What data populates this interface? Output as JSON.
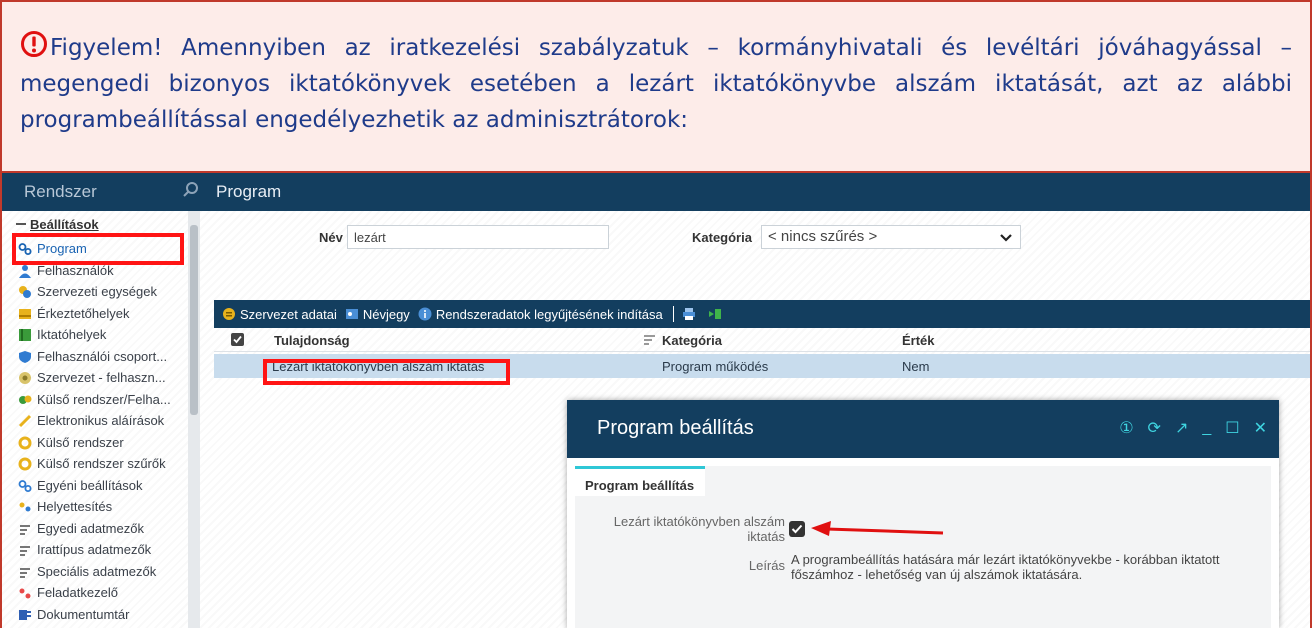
{
  "notice": {
    "text": "Figyelem! Amennyiben az iratkezelési szabályzatuk – kormányhivatali és levéltári jóváhagyással – megengedi bizonyos iktatókönyvek esetében a lezárt iktatókönyvbe alszám iktatását, azt az alábbi programbeállítással engedélyezhetik az adminisztrátorok:",
    "color": "#1f3b8a",
    "border_color": "#c0392b"
  },
  "topbar": {
    "left_title": "Rendszer",
    "right_title": "Program"
  },
  "sidebar": {
    "root": "Beállítások",
    "items": [
      {
        "label": "Program",
        "icon": "gears-icon"
      },
      {
        "label": "Felhasználók",
        "icon": "user-icon"
      },
      {
        "label": "Szervezeti egységek",
        "icon": "org-icon"
      },
      {
        "label": "Érkeztetőhelyek",
        "icon": "inbox-icon"
      },
      {
        "label": "Iktatóhelyek",
        "icon": "book-icon"
      },
      {
        "label": "Felhasználói csoport...",
        "icon": "shield-icon"
      },
      {
        "label": "Szervezet - felhaszn...",
        "icon": "org-user-icon"
      },
      {
        "label": "Külső rendszer/Felha...",
        "icon": "external-user-icon"
      },
      {
        "label": "Elektronikus aláírások",
        "icon": "pen-icon"
      },
      {
        "label": "Külső rendszer",
        "icon": "ring-icon"
      },
      {
        "label": "Külső rendszer szűrők",
        "icon": "ring-icon"
      },
      {
        "label": "Egyéni beállítások",
        "icon": "gears-icon"
      },
      {
        "label": "Helyettesítés",
        "icon": "substitute-icon"
      },
      {
        "label": "Egyedi adatmezők",
        "icon": "fields-icon"
      },
      {
        "label": "Irattípus adatmezők",
        "icon": "fields-icon"
      },
      {
        "label": "Speciális adatmezők",
        "icon": "fields-icon"
      },
      {
        "label": "Feladatkezelő",
        "icon": "tasks-icon"
      },
      {
        "label": "Dokumentumtár",
        "icon": "word-icon"
      }
    ]
  },
  "filter": {
    "name_label": "Név",
    "name_value": "lezárt",
    "category_label": "Kategória",
    "category_value": "< nincs szűrés >"
  },
  "toolbar": {
    "org_data": "Szervezet adatai",
    "business_card": "Névjegy",
    "collect": "Rendszeradatok legyűjtésének indítása"
  },
  "table": {
    "headers": [
      "Tulajdonság",
      "Kategória",
      "Érték"
    ],
    "rows": [
      {
        "property": "Lezárt iktatókönyvben alszám iktatás",
        "category": "Program működés",
        "value": "Nem"
      }
    ]
  },
  "modal": {
    "title": "Program beállítás",
    "tab": "Program beállítás",
    "field_label_line1": "Lezárt iktatókönyvben alszám",
    "field_label_line2": "iktatás",
    "desc_label": "Leírás",
    "desc_line1": "A programbeállítás hatására már lezárt iktatókönyvekbe - korábban iktatott",
    "desc_line2": "főszámhoz - lehetőség van új alszámok iktatására."
  },
  "colors": {
    "dark_blue": "#133e5f",
    "accent_cyan": "#2fc7d6",
    "highlight_red": "#ff1414"
  }
}
